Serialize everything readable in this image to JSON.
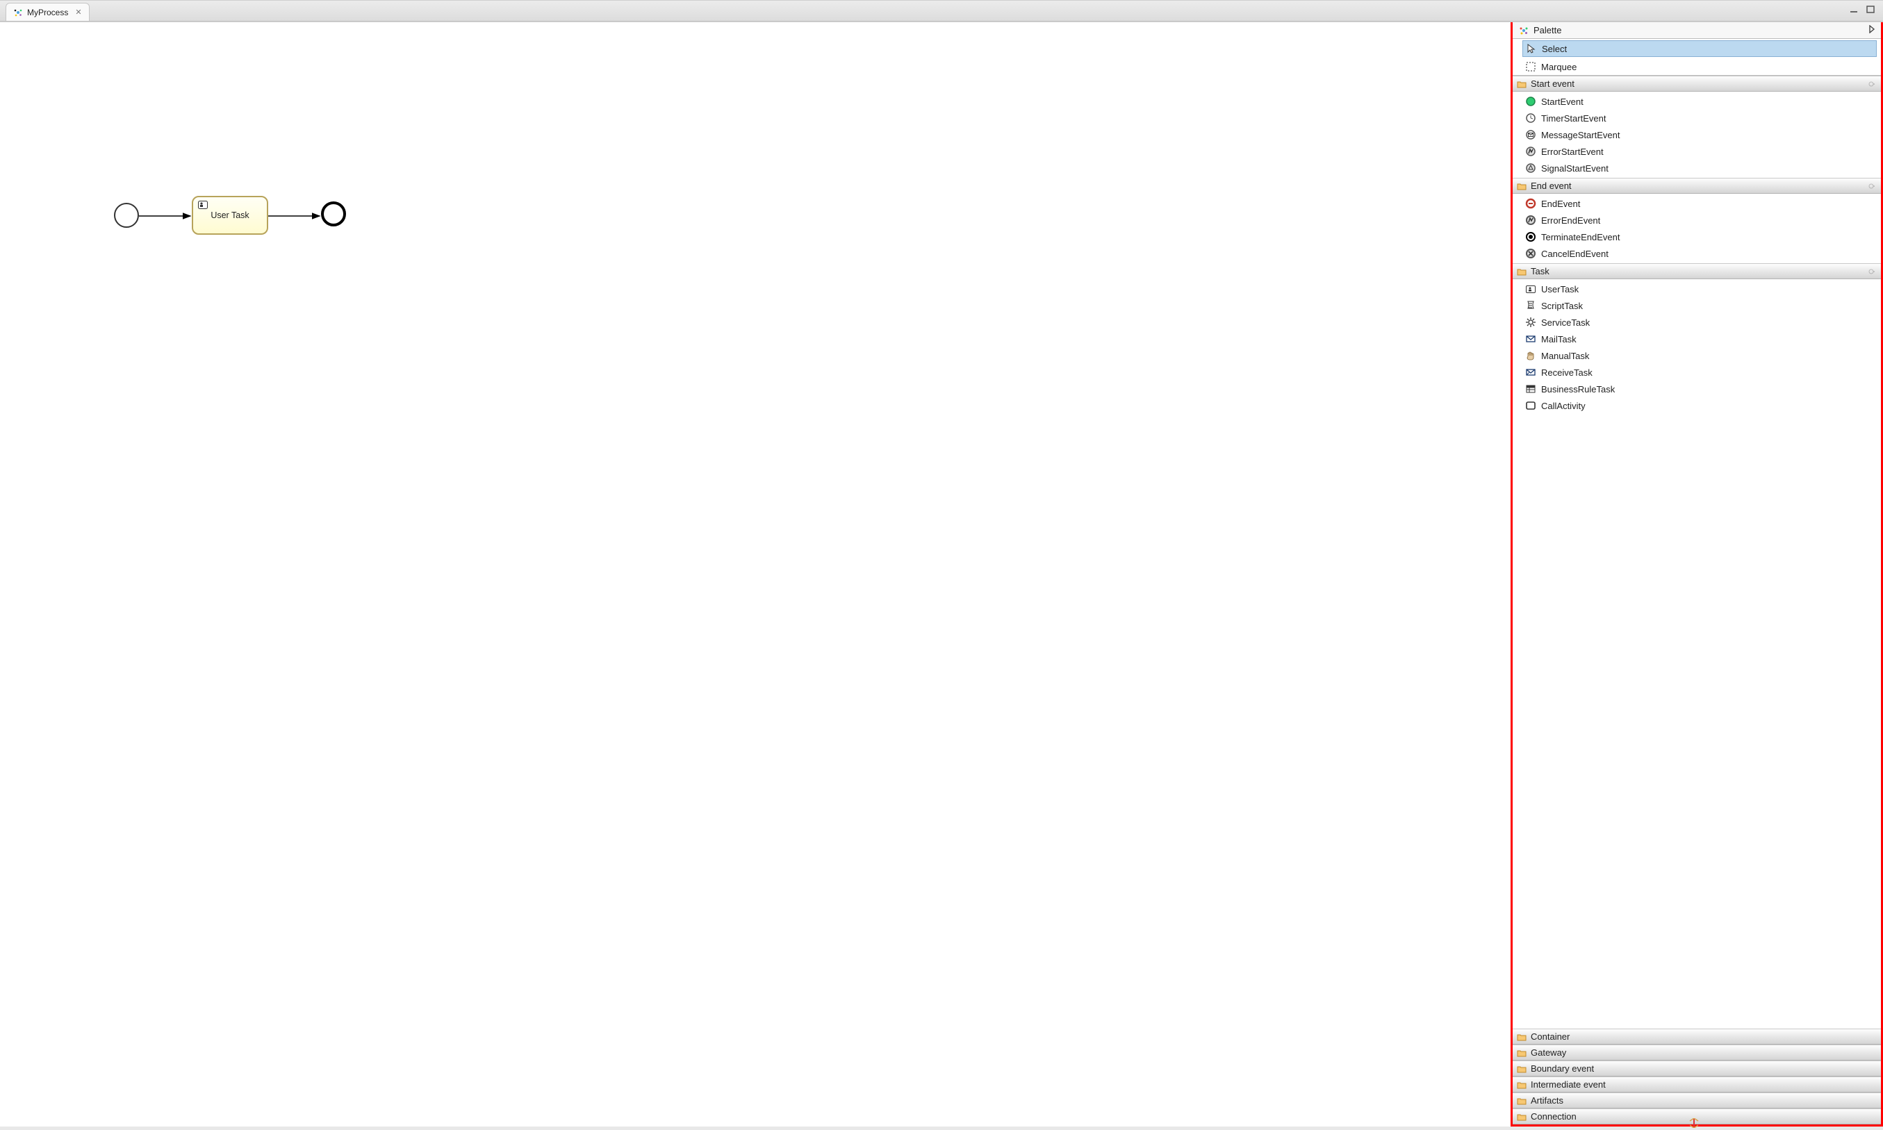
{
  "tab": {
    "title": "MyProcess",
    "close_symbol": "✕"
  },
  "canvas": {
    "user_task_label": "User Task"
  },
  "palette_title": "Palette",
  "tools": {
    "select": "Select",
    "marquee": "Marquee"
  },
  "drawers": {
    "start_event": {
      "title": "Start event",
      "items": [
        "StartEvent",
        "TimerStartEvent",
        "MessageStartEvent",
        "ErrorStartEvent",
        "SignalStartEvent"
      ]
    },
    "end_event": {
      "title": "End event",
      "items": [
        "EndEvent",
        "ErrorEndEvent",
        "TerminateEndEvent",
        "CancelEndEvent"
      ]
    },
    "task": {
      "title": "Task",
      "items": [
        "UserTask",
        "ScriptTask",
        "ServiceTask",
        "MailTask",
        "ManualTask",
        "ReceiveTask",
        "BusinessRuleTask",
        "CallActivity"
      ]
    },
    "container": "Container",
    "gateway": "Gateway",
    "boundary_event": "Boundary event",
    "intermediate_event": "Intermediate event",
    "artifacts": "Artifacts",
    "connection": "Connection"
  }
}
